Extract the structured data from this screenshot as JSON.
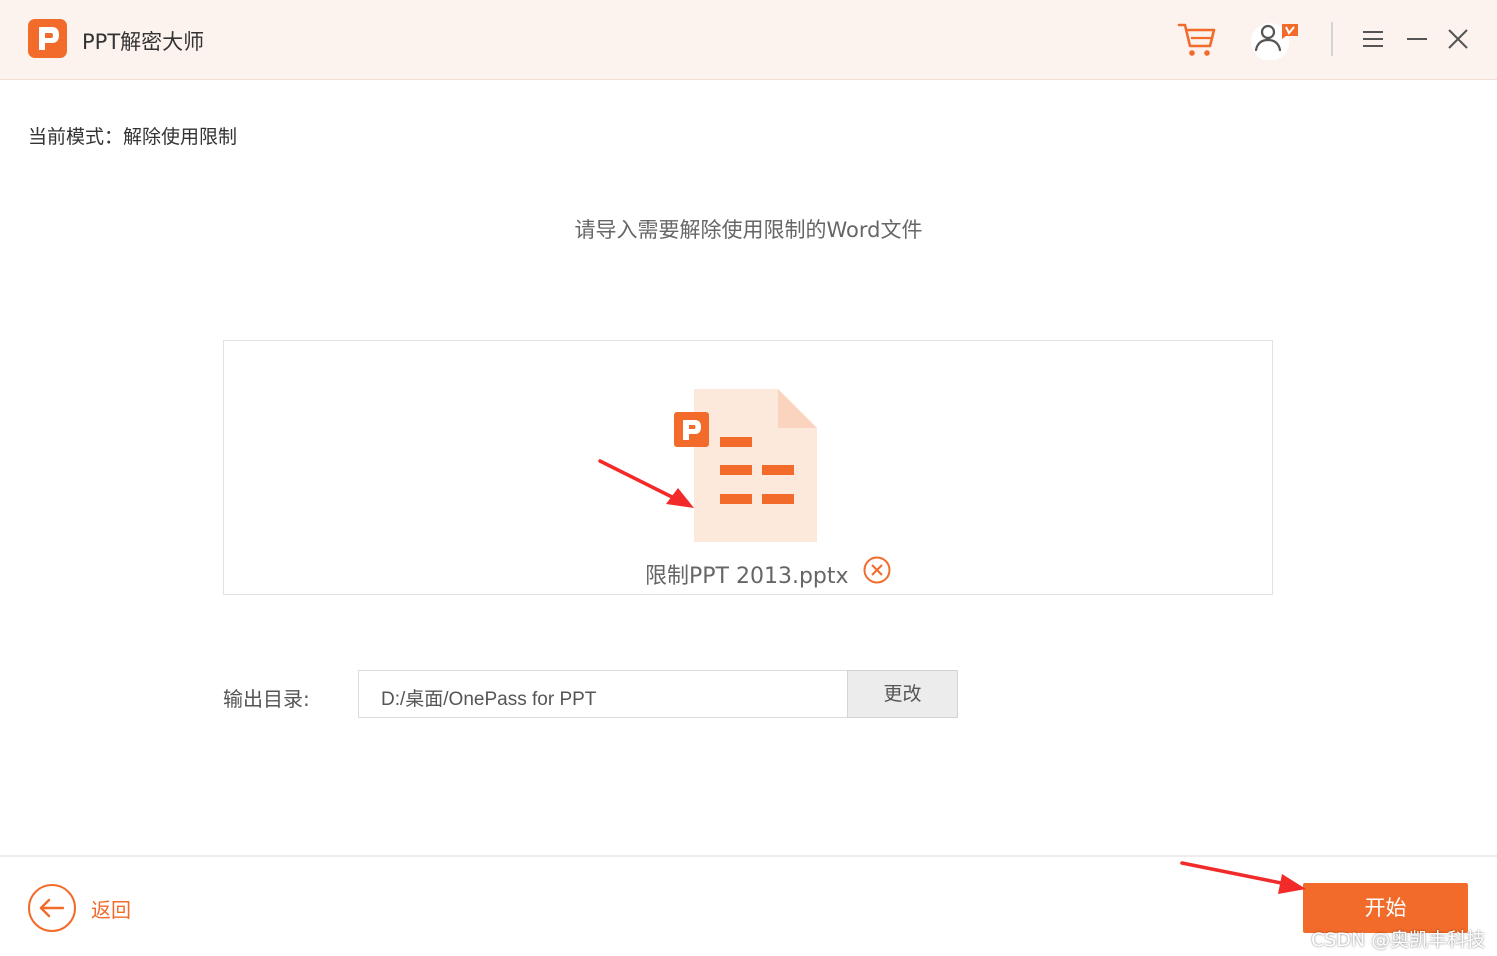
{
  "app": {
    "title": "PPT解密大师"
  },
  "titlebar": {
    "icons": [
      "cart-icon",
      "user-vip-icon",
      "menu-icon",
      "minimize-icon",
      "close-icon"
    ]
  },
  "mode": {
    "label": "当前模式：解除使用限制"
  },
  "main": {
    "prompt": "请导入需要解除使用限制的Word文件",
    "file": {
      "name": "限制PPT 2013.pptx",
      "icon": "pptx-file-icon"
    }
  },
  "output": {
    "label": "输出目录:",
    "path": "D:/桌面/OnePass for PPT",
    "change_label": "更改"
  },
  "footer": {
    "back_label": "返回",
    "start_label": "开始"
  },
  "watermark": "CSDN @奥凯丰科技",
  "colors": {
    "accent": "#f26b2a",
    "titlebar_bg": "#fdf3ee",
    "file_icon_bg": "#fde8dc",
    "annotation_arrow": "#f22a2a"
  }
}
